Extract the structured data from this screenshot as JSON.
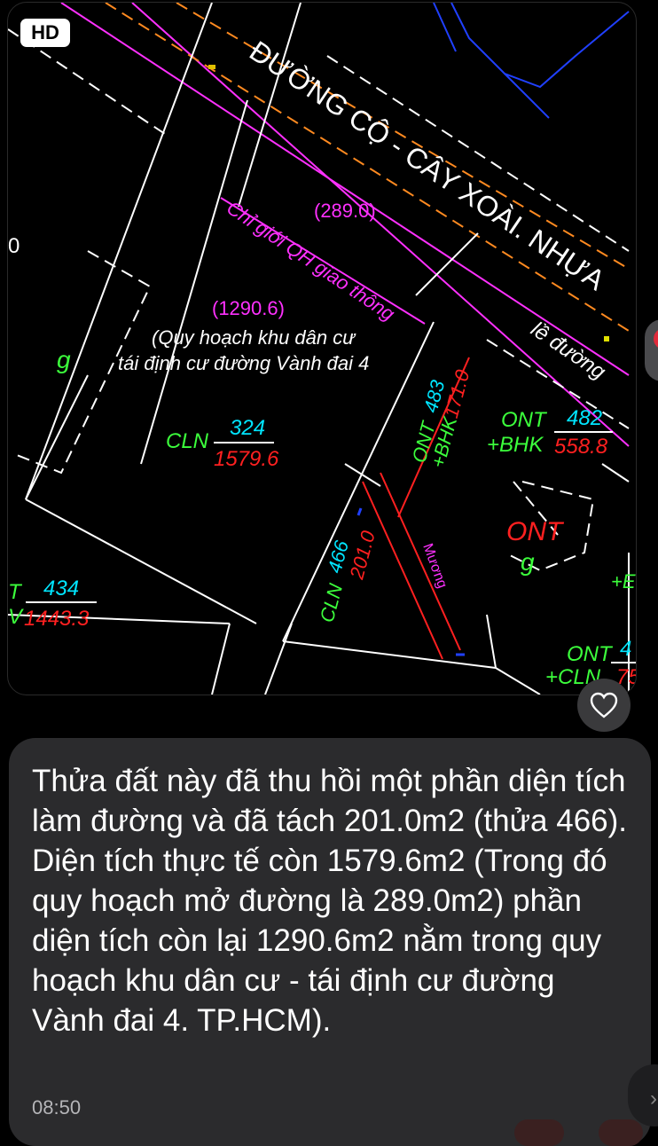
{
  "map": {
    "hd_badge": "HD",
    "road_name": "ĐƯỜNG CỘ - CÂY XOÀI. NHỰA",
    "boundary_label": "Chỉ giới QH giao thông",
    "area_road": "(289.0)",
    "area_plan": "(1290.6)",
    "plan_note_line1": "(Quy hoạch khu dân cư",
    "plan_note_line2": "tái định cư đường Vành đai 4",
    "main_parcel": {
      "code": "CLN",
      "number": "324",
      "area": "1579.6"
    },
    "sidewalk_label": "lề đường",
    "parcel_483": {
      "code1": "ONT",
      "code2": "+BHK",
      "number": "483",
      "area": "171.0"
    },
    "parcel_482": {
      "code1": "ONT",
      "code2": "+BHK",
      "number": "482",
      "area": "558.8"
    },
    "parcel_466": {
      "code": "CLN",
      "number": "466",
      "area": "201.0"
    },
    "canal_label": "Mương",
    "building_code": "ONT",
    "building_g": "g",
    "left_g": "g",
    "left_parcel": {
      "code": "T",
      "code2": "V",
      "number": "434",
      "area": "1443.3"
    },
    "bottom_right": {
      "code1": "ONT",
      "code2": "+CLN",
      "number": "4",
      "area": "75"
    },
    "edge_plus": "+E",
    "edge_zero": "0"
  },
  "message": {
    "text": "Thửa đất này đã thu hồi một phần diện tích làm đường và đã tách 201.0m2 (thửa 466).\nDiện tích thực tế còn 1579.6m2 (Trong đó quy hoạch mở đường là 289.0m2) phần diện tích còn lại 1290.6m2 nằm trong quy hoạch khu dân cư - tái định cư đường Vành đai 4. TP.HCM).",
    "time": "08:50"
  },
  "icons": {
    "heart": "heart-icon",
    "chevron": "chevron-right-icon"
  },
  "colors": {
    "cyan": "#00e5ff",
    "red": "#ff2020",
    "magenta": "#ff30ff",
    "green": "#3cff3c",
    "blue": "#2040ff",
    "bubble": "#2b2b2d"
  }
}
